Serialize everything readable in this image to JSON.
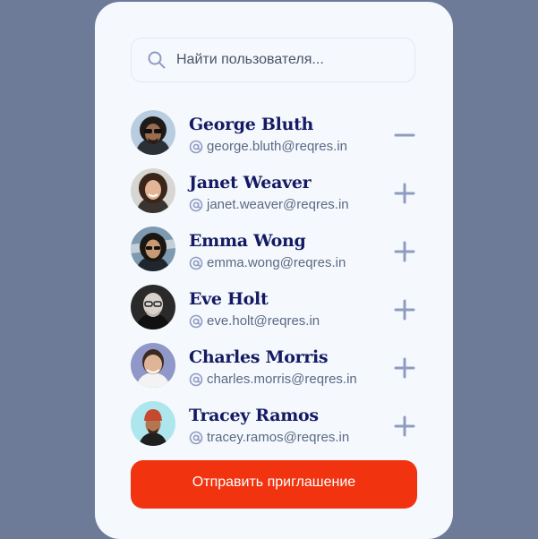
{
  "search": {
    "placeholder": "Найти пользователя...",
    "value": "",
    "icon": "search-icon"
  },
  "users": [
    {
      "name": "George Bluth",
      "email": "george.bluth@reqres.in",
      "invited": true,
      "action_icon": "minus-icon"
    },
    {
      "name": "Janet Weaver",
      "email": "janet.weaver@reqres.in",
      "invited": false,
      "action_icon": "plus-icon"
    },
    {
      "name": "Emma Wong",
      "email": "emma.wong@reqres.in",
      "invited": false,
      "action_icon": "plus-icon"
    },
    {
      "name": "Eve Holt",
      "email": "eve.holt@reqres.in",
      "invited": false,
      "action_icon": "plus-icon"
    },
    {
      "name": "Charles Morris",
      "email": "charles.morris@reqres.in",
      "invited": false,
      "action_icon": "plus-icon"
    },
    {
      "name": "Tracey Ramos",
      "email": "tracey.ramos@reqres.in",
      "invited": false,
      "action_icon": "plus-icon"
    }
  ],
  "send_button": {
    "label": "Отправить приглашение"
  },
  "colors": {
    "background": "#6d7b98",
    "card": "#f5f8fd",
    "name": "#131a62",
    "email": "#5b6a84",
    "icon": "#8e9cc0",
    "accent": "#f2330f"
  }
}
